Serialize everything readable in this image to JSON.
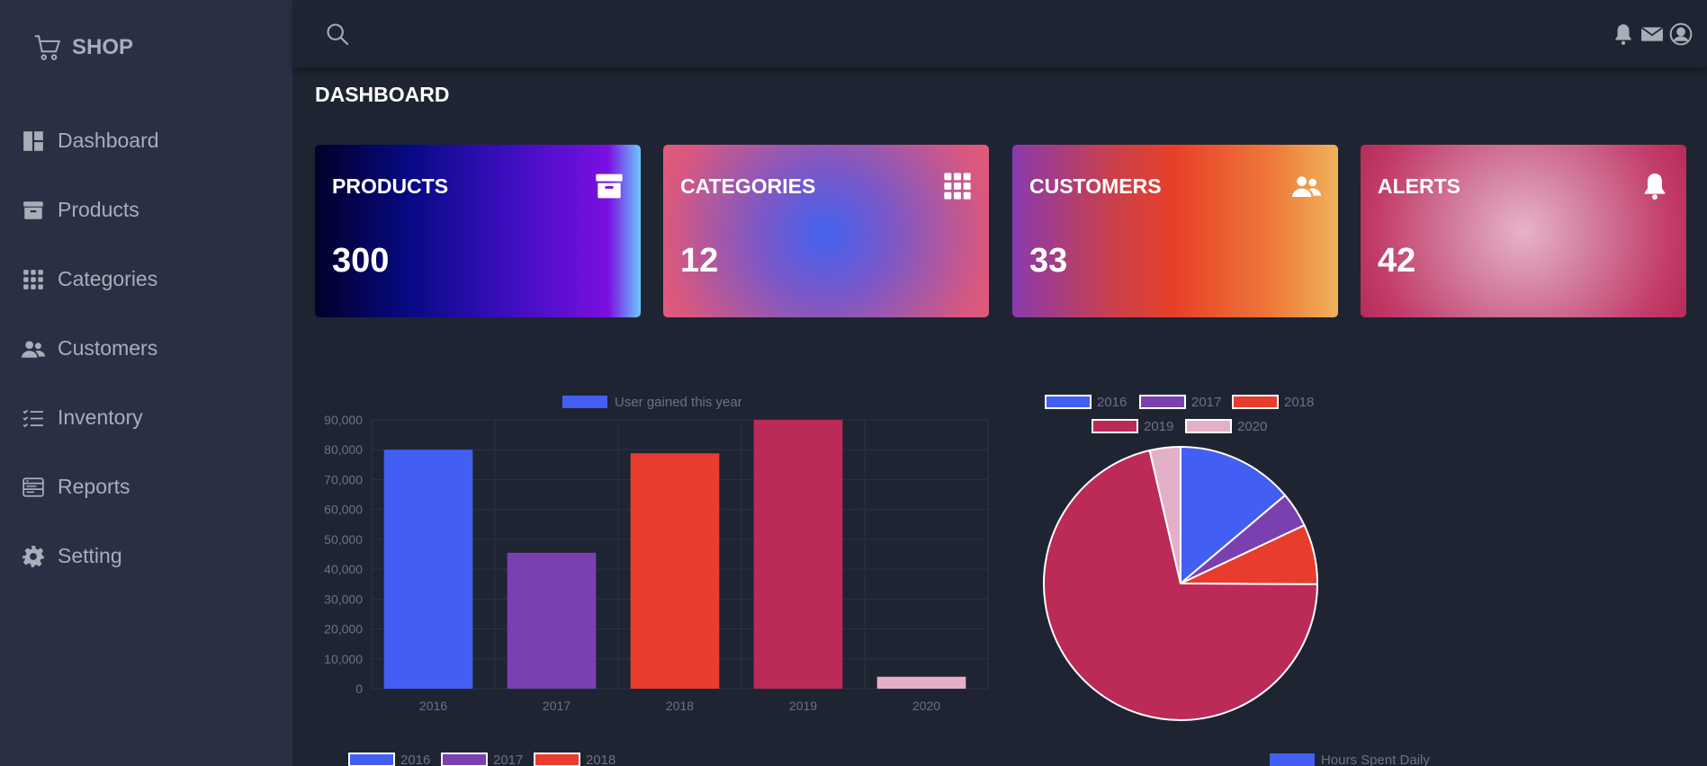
{
  "brand": {
    "name": "SHOP",
    "icon": "cart-icon"
  },
  "sidebar": {
    "items": [
      {
        "label": "Dashboard",
        "icon": "dashboard-icon"
      },
      {
        "label": "Products",
        "icon": "archive-icon"
      },
      {
        "label": "Categories",
        "icon": "grid-icon"
      },
      {
        "label": "Customers",
        "icon": "people-icon"
      },
      {
        "label": "Inventory",
        "icon": "checklist-icon"
      },
      {
        "label": "Reports",
        "icon": "reports-icon"
      },
      {
        "label": "Setting",
        "icon": "gear-icon"
      }
    ]
  },
  "topbar": {
    "icons": [
      "search-icon",
      "bell-icon",
      "mail-icon",
      "user-icon"
    ]
  },
  "page": {
    "title": "DASHBOARD"
  },
  "cards": [
    {
      "title": "PRODUCTS",
      "value": "300",
      "icon": "archive-icon"
    },
    {
      "title": "CATEGORIES",
      "value": "12",
      "icon": "grid-icon"
    },
    {
      "title": "CUSTOMERS",
      "value": "33",
      "icon": "people-icon"
    },
    {
      "title": "ALERTS",
      "value": "42",
      "icon": "bell-icon"
    }
  ],
  "colors": {
    "y2016": "#435ef2",
    "y2017": "#7b40b0",
    "y2018": "#e83c2e",
    "y2019": "#bc2a58",
    "y2020": "#e4b0c8"
  },
  "chart_data": [
    {
      "type": "bar",
      "categories": [
        "2016",
        "2017",
        "2018",
        "2019",
        "2020"
      ],
      "series": [
        {
          "name": "User gained this year",
          "values": [
            80000,
            45500,
            78800,
            90000,
            4000
          ]
        }
      ],
      "ylim": [
        0,
        90000
      ],
      "yticks": [
        "0",
        "10,000",
        "20,000",
        "30,000",
        "40,000",
        "50,000",
        "60,000",
        "70,000",
        "80,000",
        "90,000"
      ],
      "legend": "top",
      "grid": true
    },
    {
      "type": "pie",
      "labels": [
        "2016",
        "2017",
        "2018",
        "2019",
        "2020"
      ],
      "values": [
        80000,
        24000,
        41000,
        412000,
        21000
      ],
      "legend": "top"
    }
  ],
  "bottom_legends": {
    "left": [
      "2016",
      "2017",
      "2018"
    ],
    "right": "Hours Spent Daily"
  }
}
